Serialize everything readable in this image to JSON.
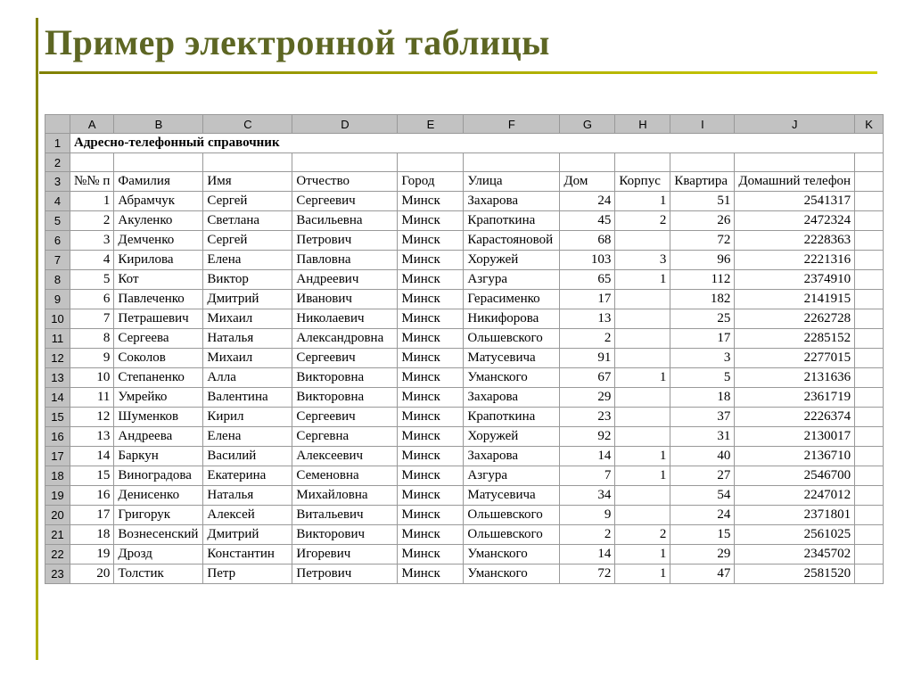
{
  "slide_title": "Пример электронной таблицы",
  "columns": [
    "A",
    "B",
    "C",
    "D",
    "E",
    "F",
    "G",
    "H",
    "I",
    "J",
    "K"
  ],
  "sheet": {
    "title_row_text": "Адресно-телефонный справочник",
    "headers": {
      "A": "№№ п",
      "B": "Фамилия",
      "C": "Имя",
      "D": "Отчество",
      "E": "Город",
      "F": "Улица",
      "G": "Дом",
      "H": "Корпус",
      "I": "Квартира",
      "J": "Домашний телефон",
      "K": ""
    },
    "rows": [
      {
        "n": 1,
        "fam": "Абрамчук",
        "name": "Сергей",
        "patr": "Сергеевич",
        "city": "Минск",
        "street": "Захарова",
        "house": 24,
        "block": 1,
        "apt": 51,
        "phone": "2541317"
      },
      {
        "n": 2,
        "fam": "Акуленко",
        "name": "Светлана",
        "patr": "Васильевна",
        "city": "Минск",
        "street": "Крапоткина",
        "house": 45,
        "block": 2,
        "apt": 26,
        "phone": "2472324"
      },
      {
        "n": 3,
        "fam": "Демченко",
        "name": "Сергей",
        "patr": "Петрович",
        "city": "Минск",
        "street": "Карастояновой",
        "house": 68,
        "block": "",
        "apt": 72,
        "phone": "2228363"
      },
      {
        "n": 4,
        "fam": "Кирилова",
        "name": "Елена",
        "patr": "Павловна",
        "city": "Минск",
        "street": "Хоружей",
        "house": 103,
        "block": 3,
        "apt": 96,
        "phone": "2221316"
      },
      {
        "n": 5,
        "fam": "Кот",
        "name": "Виктор",
        "patr": "Андреевич",
        "city": "Минск",
        "street": "Азгура",
        "house": 65,
        "block": 1,
        "apt": 112,
        "phone": "2374910"
      },
      {
        "n": 6,
        "fam": "Павлеченко",
        "name": "Дмитрий",
        "patr": "Иванович",
        "city": "Минск",
        "street": "Герасименко",
        "house": 17,
        "block": "",
        "apt": 182,
        "phone": "2141915"
      },
      {
        "n": 7,
        "fam": "Петрашевич",
        "name": "Михаил",
        "patr": "Николаевич",
        "city": "Минск",
        "street": "Никифорова",
        "house": 13,
        "block": "",
        "apt": 25,
        "phone": "2262728"
      },
      {
        "n": 8,
        "fam": "Сергеева",
        "name": "Наталья",
        "patr": "Александровна",
        "city": "Минск",
        "street": "Ольшевского",
        "house": 2,
        "block": "",
        "apt": 17,
        "phone": "2285152"
      },
      {
        "n": 9,
        "fam": "Соколов",
        "name": "Михаил",
        "patr": "Сергеевич",
        "city": "Минск",
        "street": "Матусевича",
        "house": 91,
        "block": "",
        "apt": 3,
        "phone": "2277015"
      },
      {
        "n": 10,
        "fam": "Степаненко",
        "name": "Алла",
        "patr": "Викторовна",
        "city": "Минск",
        "street": "Уманского",
        "house": 67,
        "block": 1,
        "apt": 5,
        "phone": "2131636"
      },
      {
        "n": 11,
        "fam": "Умрейко",
        "name": "Валентина",
        "patr": "Викторовна",
        "city": "Минск",
        "street": "Захарова",
        "house": 29,
        "block": "",
        "apt": 18,
        "phone": "2361719"
      },
      {
        "n": 12,
        "fam": "Шуменков",
        "name": "Кирил",
        "patr": "Сергеевич",
        "city": "Минск",
        "street": "Крапоткина",
        "house": 23,
        "block": "",
        "apt": 37,
        "phone": "2226374"
      },
      {
        "n": 13,
        "fam": "Андреева",
        "name": "Елена",
        "patr": "Сергевна",
        "city": "Минск",
        "street": "Хоружей",
        "house": 92,
        "block": "",
        "apt": 31,
        "phone": "2130017"
      },
      {
        "n": 14,
        "fam": "Баркун",
        "name": "Василий",
        "patr": "Алексеевич",
        "city": "Минск",
        "street": "Захарова",
        "house": 14,
        "block": 1,
        "apt": 40,
        "phone": "2136710"
      },
      {
        "n": 15,
        "fam": "Виноградова",
        "name": "Екатерина",
        "patr": "Семеновна",
        "city": "Минск",
        "street": "Азгура",
        "house": 7,
        "block": 1,
        "apt": 27,
        "phone": "2546700"
      },
      {
        "n": 16,
        "fam": "Денисенко",
        "name": "Наталья",
        "patr": "Михайловна",
        "city": "Минск",
        "street": "Матусевича",
        "house": 34,
        "block": "",
        "apt": 54,
        "phone": "2247012"
      },
      {
        "n": 17,
        "fam": "Григорук",
        "name": "Алексей",
        "patr": "Витальевич",
        "city": "Минск",
        "street": "Ольшевского",
        "house": 9,
        "block": "",
        "apt": 24,
        "phone": "2371801"
      },
      {
        "n": 18,
        "fam": "Вознесенский",
        "name": "Дмитрий",
        "patr": "Викторович",
        "city": "Минск",
        "street": "Ольшевского",
        "house": 2,
        "block": 2,
        "apt": 15,
        "phone": "2561025"
      },
      {
        "n": 19,
        "fam": "Дрозд",
        "name": "Константин",
        "patr": "Игоревич",
        "city": "Минск",
        "street": "Уманского",
        "house": 14,
        "block": 1,
        "apt": 29,
        "phone": "2345702"
      },
      {
        "n": 20,
        "fam": "Толстик",
        "name": "Петр",
        "patr": "Петрович",
        "city": "Минск",
        "street": "Уманского",
        "house": 72,
        "block": 1,
        "apt": 47,
        "phone": "2581520"
      }
    ]
  }
}
